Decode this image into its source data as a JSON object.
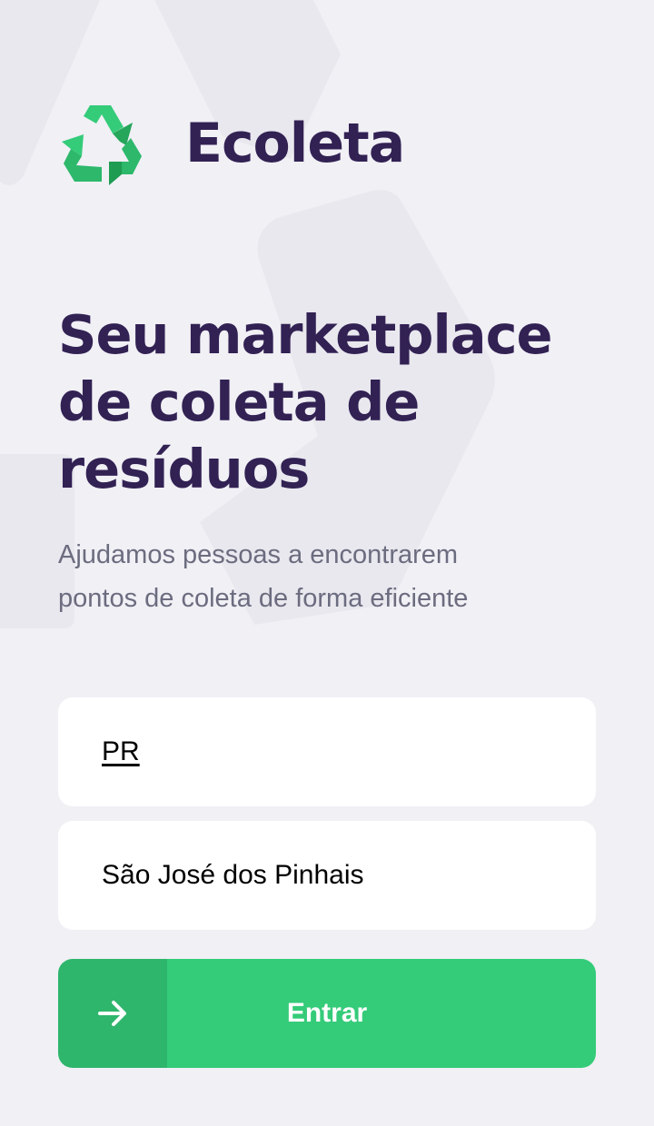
{
  "app": {
    "name": "Ecoleta",
    "logo_icon": "recycle-icon"
  },
  "hero": {
    "title_lines": [
      "Seu marketplace",
      "de coleta de",
      "resíduos"
    ],
    "subtitle_lines": [
      "Ajudamos pessoas a encontrarem",
      "pontos de coleta de forma eficiente"
    ]
  },
  "form": {
    "uf_value": "PR",
    "city_value": "São José dos Pinhais"
  },
  "button": {
    "label": "Entrar",
    "icon": "arrow-right-icon"
  },
  "colors": {
    "background": "#F0F0F5",
    "title": "#322153",
    "text": "#6C6C80",
    "primary": "#34CB79",
    "field": "#FFFFFF"
  }
}
